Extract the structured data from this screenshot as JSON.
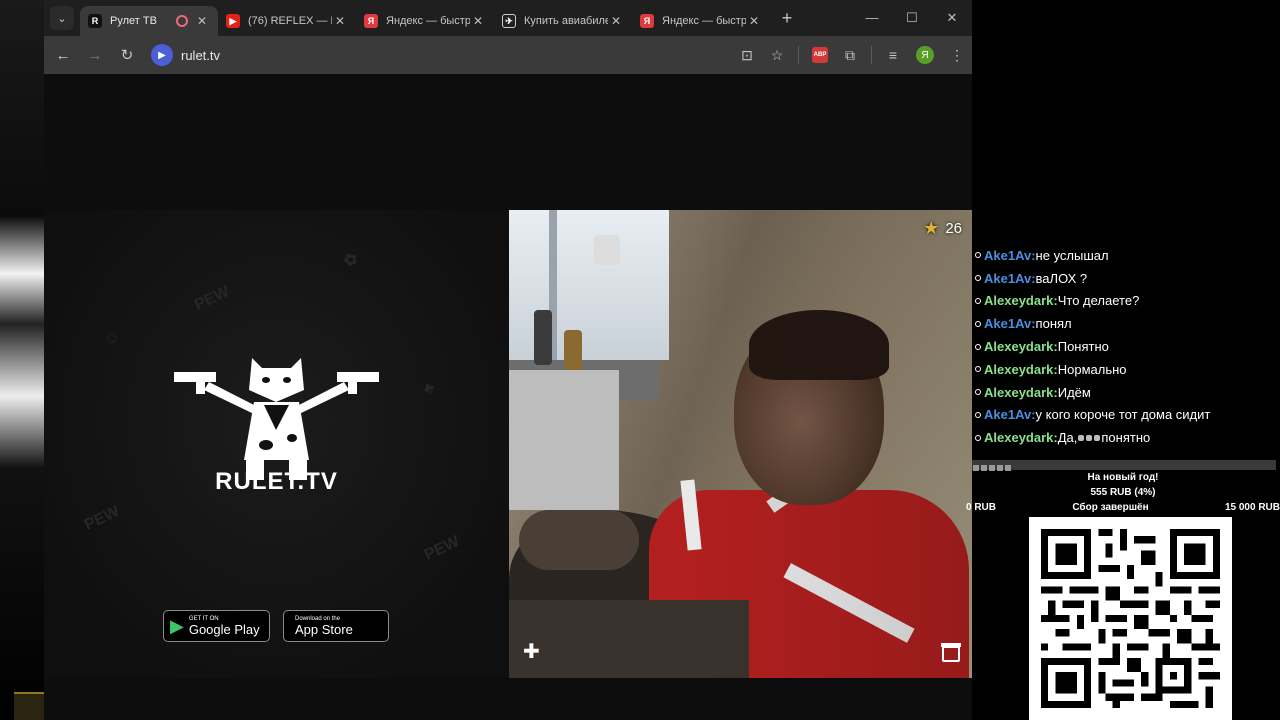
{
  "browser": {
    "tabs": [
      {
        "title": "Рулет ТВ",
        "active": true,
        "favicon_color": "#111111",
        "recording": true
      },
      {
        "title": "(76) REFLEX — П",
        "favicon_color": "#e62117"
      },
      {
        "title": "Яндекс — быстр",
        "favicon_color": "#e0393e"
      },
      {
        "title": "Купить авиабиле",
        "favicon_color": "#222222"
      },
      {
        "title": "Яндекс — быстр",
        "favicon_color": "#e0393e"
      }
    ],
    "new_tab": "+",
    "url": "rulet.tv",
    "abp": "ABP",
    "profile_initial": "Я"
  },
  "rulet": {
    "brand": "RULET.TV",
    "google_play_small": "GET IT ON",
    "google_play_big": "Google Play",
    "app_store_small": "Download on the",
    "app_store_big": "App Store",
    "stars": "26"
  },
  "chat": [
    {
      "nick": "Ake1Av:",
      "text": "не услышал",
      "color": "blue"
    },
    {
      "nick": "Ake1Av:",
      "text": "ваЛОХ ?",
      "color": "blue"
    },
    {
      "nick": "Alexeydark:",
      "text": "Что делаете?",
      "color": "green"
    },
    {
      "nick": "Ake1Av:",
      "text": "понял",
      "color": "blue"
    },
    {
      "nick": "Alexeydark:",
      "text": "Понятно",
      "color": "green"
    },
    {
      "nick": "Alexeydark:",
      "text": "Нормально",
      "color": "green"
    },
    {
      "nick": "Alexeydark:",
      "text": "Идём",
      "color": "green"
    },
    {
      "nick": "Ake1Av:",
      "text": "у кого короче тот дома сидит",
      "color": "blue"
    },
    {
      "nick": "Alexeydark:",
      "text": "Да, ",
      "text2": " понятно",
      "color": "green",
      "emotes": true
    }
  ],
  "goal": {
    "title": "На новый год!",
    "amount": "555 RUB (4%)",
    "min": "0 RUB",
    "status": "Сбор завершён",
    "max": "15 000 RUB"
  },
  "colors": {
    "nick_blue": "#4a8fe0",
    "nick_green": "#8be08b",
    "star": "#e0b23a"
  }
}
